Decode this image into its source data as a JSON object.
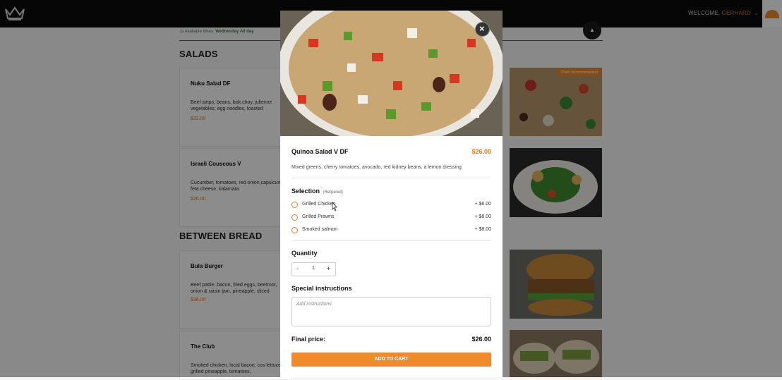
{
  "header": {
    "welcome_label": "WELCOME, ",
    "username": "GERHARD",
    "chevron": "⌄",
    "logo_icon": "crown-logo-icon",
    "cart_icon": "cart-icon"
  },
  "availability": {
    "label": "Available times:",
    "value": "Wednesday All day"
  },
  "menu": {
    "salads_title": "SALADS",
    "between_bread_title": "BETWEEN BREAD",
    "items": [
      {
        "name": "Nuku Salad DF",
        "desc": "Beef strips, beans, bok choy, julienne vegetables, egg noodles, toasted",
        "price": "$32.00"
      },
      {
        "name": "Israeli Couscous V",
        "desc": "Cucumber, tomatoes, red onion,capsicum, feta cheese, kalamata",
        "price": "$26.00"
      },
      {
        "name": "Bula Burger",
        "desc": "Beef pattie, bacon, fried eggs, beetroot, onion & raisin jam, pineapple, sliced",
        "price": "$36.00"
      },
      {
        "name": "The Club",
        "desc": "Smoked chicken, local bacon, cos lettuce, grilled pineapple, tomatoes,",
        "price": ""
      }
    ],
    "badge": "Chef's recommendation"
  },
  "modal": {
    "close_label": "×",
    "item_name": "Quinoa Salad V DF",
    "item_price": "$26.00",
    "item_desc": "Mixed greens, cherry tomatoes, avocado, red kidney beans, a lemon dressing",
    "selection_title": "Selection",
    "selection_required": "(Required)",
    "options": [
      {
        "label": "Grilled Chicken",
        "price": "+ $6.00"
      },
      {
        "label": "Grilled Prawns",
        "price": "+ $8.00"
      },
      {
        "label": "Smoked salmon",
        "price": "+ $8.00"
      }
    ],
    "quantity_title": "Quantity",
    "qty_minus": "-",
    "qty_value": "1",
    "qty_plus": "+",
    "special_title": "Special instructions",
    "special_placeholder": "Add instructions",
    "final_label": "Final price:",
    "final_value": "$26.00",
    "add_button": "ADD TO CART"
  },
  "colors": {
    "accent": "#f08a2c",
    "price_orange": "#e07a24",
    "topbar": "#0b0b0b"
  }
}
